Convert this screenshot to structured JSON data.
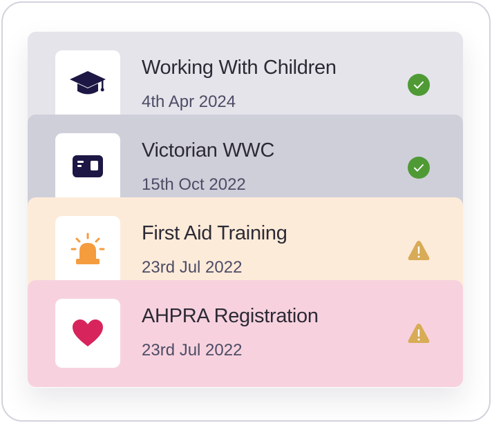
{
  "cards": [
    {
      "title": "Working With Children",
      "date": "4th Apr 2024",
      "icon": "graduation-cap-icon",
      "icon_color": "#1c1744",
      "status": "verified",
      "status_color": "#4f9a35"
    },
    {
      "title": "Victorian WWC",
      "date": "15th Oct 2022",
      "icon": "id-card-icon",
      "icon_color": "#1c1744",
      "status": "verified",
      "status_color": "#4f9a35"
    },
    {
      "title": "First Aid Training",
      "date": "23rd Jul 2022",
      "icon": "siren-alarm-icon",
      "icon_color": "#f59c3f",
      "status": "warning",
      "status_color": "#d8ab57"
    },
    {
      "title": "AHPRA Registration",
      "date": "23rd Jul 2022",
      "icon": "heart-icon",
      "icon_color": "#d8245c",
      "status": "warning",
      "status_color": "#d8ab57"
    }
  ]
}
